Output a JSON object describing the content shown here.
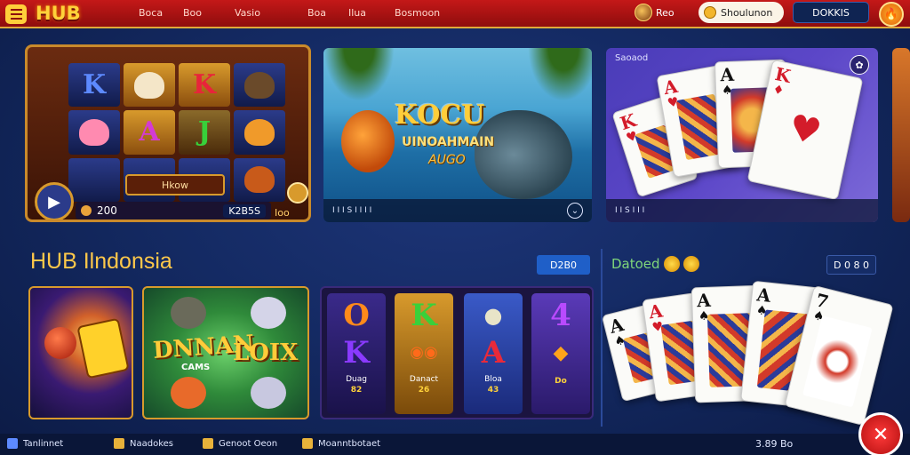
{
  "header": {
    "logo": "HUB",
    "nav": [
      "Boca",
      "Boo",
      "Vasio",
      "Boa",
      "Ilua",
      "Bosmoon"
    ],
    "user_name": "Reo",
    "search_text": "Shoulunon",
    "login_label": "DOKKIS",
    "colors": {
      "bar": "#c41818",
      "accent": "#ffd23a"
    }
  },
  "banners": {
    "slot": {
      "tiles": [
        "K",
        "",
        "K",
        "",
        "",
        "A",
        "J",
        "",
        "",
        "",
        "",
        ""
      ],
      "badge": "Hkow",
      "balance": "200",
      "bet": "K2B5S",
      "side": "Ioo"
    },
    "fish": {
      "title": "KOCU",
      "subtitle": "UINOAHMAIN",
      "tagline": "AUGO",
      "footer": "I I I  S I I I I"
    },
    "cards": {
      "tag": "Saoaod",
      "footer": "I I S I I I"
    }
  },
  "section": {
    "title": "HUB Ilndonsia",
    "button": "D2B0",
    "right_title": "Datoed",
    "right_button": "D 0 8 0"
  },
  "games": {
    "tile2": {
      "word1": "DNNAN",
      "word2": "LOIX",
      "sub": "CAMS"
    },
    "reels": [
      {
        "sym_top": "O",
        "sym_bottom": "K",
        "label": "Duag",
        "num": "82"
      },
      {
        "sym_top": "K",
        "sym_bottom": "",
        "label": "Danact",
        "num": "26"
      },
      {
        "sym_top": "",
        "sym_bottom": "A",
        "label": "Bloa",
        "num": "43"
      },
      {
        "sym_top": "4",
        "sym_bottom": "",
        "label": "",
        "num": "Do"
      }
    ]
  },
  "footer": {
    "items": [
      "Tanlinnet",
      "Naadokes",
      "Genoot Oeon",
      "Moanntbotaet"
    ],
    "right_text": "3.89 Bo"
  },
  "icons": {
    "menu": "hamburger-icon",
    "user": "avatar-icon",
    "search": "coin-icon",
    "fire": "flame-icon",
    "close": "close-icon"
  }
}
